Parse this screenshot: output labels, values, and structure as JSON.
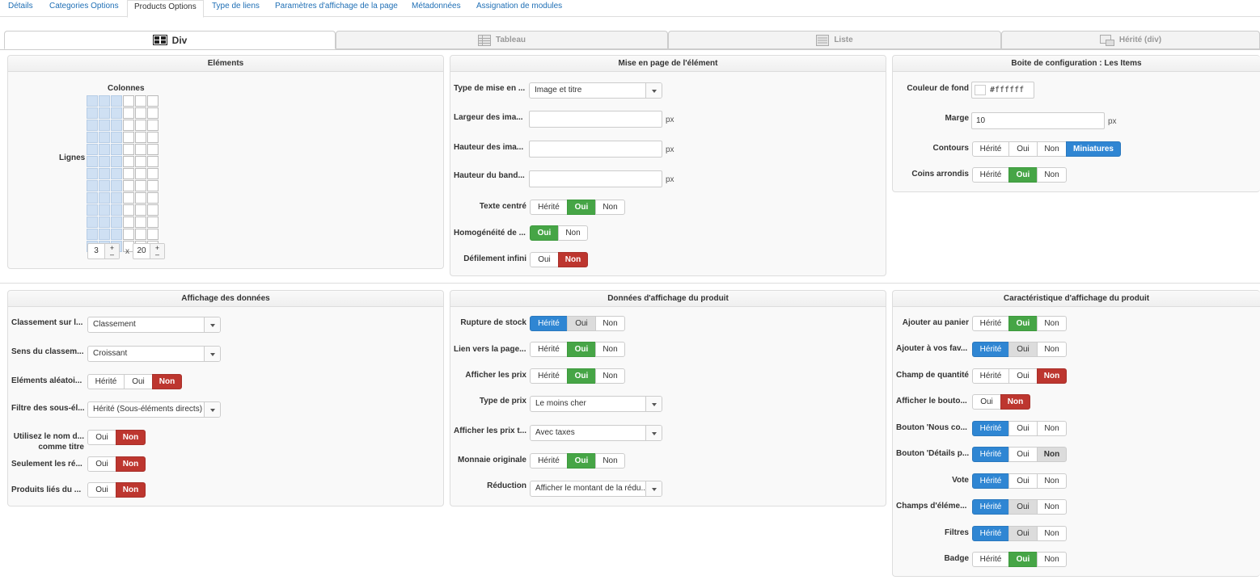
{
  "top_tabs": [
    "Détails",
    "Categories Options",
    "Products Options",
    "Type de liens",
    "Paramètres d'affichage de la page",
    "Métadonnées",
    "Assignation de modules"
  ],
  "sub_tabs": [
    "Div",
    "Tableau",
    "Liste",
    "Hérité (div)"
  ],
  "elements": {
    "title": "Eléments",
    "colonnes_label": "Colonnes",
    "lignes_label": "Lignes",
    "cols_value": "3",
    "rows_value": "20",
    "times": "x",
    "plus": "+",
    "minus": "–"
  },
  "mise_en_page": {
    "title": "Mise en page de l'élément",
    "type_label": "Type de mise en ...",
    "type_value": "Image et titre",
    "largeur_label": "Largeur des ima...",
    "hauteur_label": "Hauteur des ima...",
    "bandeau_label": "Hauteur du band...",
    "px": "px",
    "texte_centre_label": "Texte centré",
    "homogeneite_label": "Homogénéité de ...",
    "defilement_label": "Défilement infini"
  },
  "boite": {
    "title": "Boite de configuration : Les Items",
    "couleur_label": "Couleur de fond",
    "couleur_value": "#ffffff",
    "marge_label": "Marge",
    "marge_value": "10",
    "px": "px",
    "contours_label": "Contours",
    "coins_label": "Coins arrondis"
  },
  "affichage": {
    "title": "Affichage des données",
    "classement_label": "Classement sur l...",
    "classement_value": "Classement",
    "sens_label": "Sens du classem...",
    "sens_value": "Croissant",
    "aleatoire_label": "Eléments aléatoi...",
    "filtre_label": "Filtre des sous-él...",
    "filtre_value": "Hérité (Sous-éléments directs)",
    "nom_label_1": "Utilisez le nom d...",
    "nom_label_2": "comme titre",
    "seulement_label": "Seulement les ré...",
    "produits_lies_label": "Produits liés du ..."
  },
  "donnees": {
    "title": "Données d'affichage du produit",
    "rupture_label": "Rupture de stock",
    "lien_label": "Lien vers la page...",
    "prix_label": "Afficher les prix",
    "type_prix_label": "Type de prix",
    "type_prix_value": "Le moins cher",
    "prix_t_label": "Afficher les prix t...",
    "prix_t_value": "Avec taxes",
    "monnaie_label": "Monnaie originale",
    "reduction_label": "Réduction",
    "reduction_value": "Afficher le montant de la rédu..."
  },
  "caracteristique": {
    "title": "Caractéristique d'affichage du produit",
    "panier_label": "Ajouter au panier",
    "favoris_label": "Ajouter à vos fav...",
    "quantite_label": "Champ de quantité",
    "bouton_label": "Afficher le bouto...",
    "nous_label": "Bouton 'Nous co...",
    "details_label": "Bouton 'Détails p...",
    "vote_label": "Vote",
    "champs_label": "Champs d'éléme...",
    "filtres_label": "Filtres",
    "badge_label": "Badge"
  },
  "options": {
    "herite": "Hérité",
    "oui": "Oui",
    "non": "Non",
    "miniatures": "Miniatures"
  },
  "colors": {
    "green": "#46a546",
    "red": "#bd362f",
    "blue": "#2f86d3",
    "link": "#1f6fb5"
  }
}
